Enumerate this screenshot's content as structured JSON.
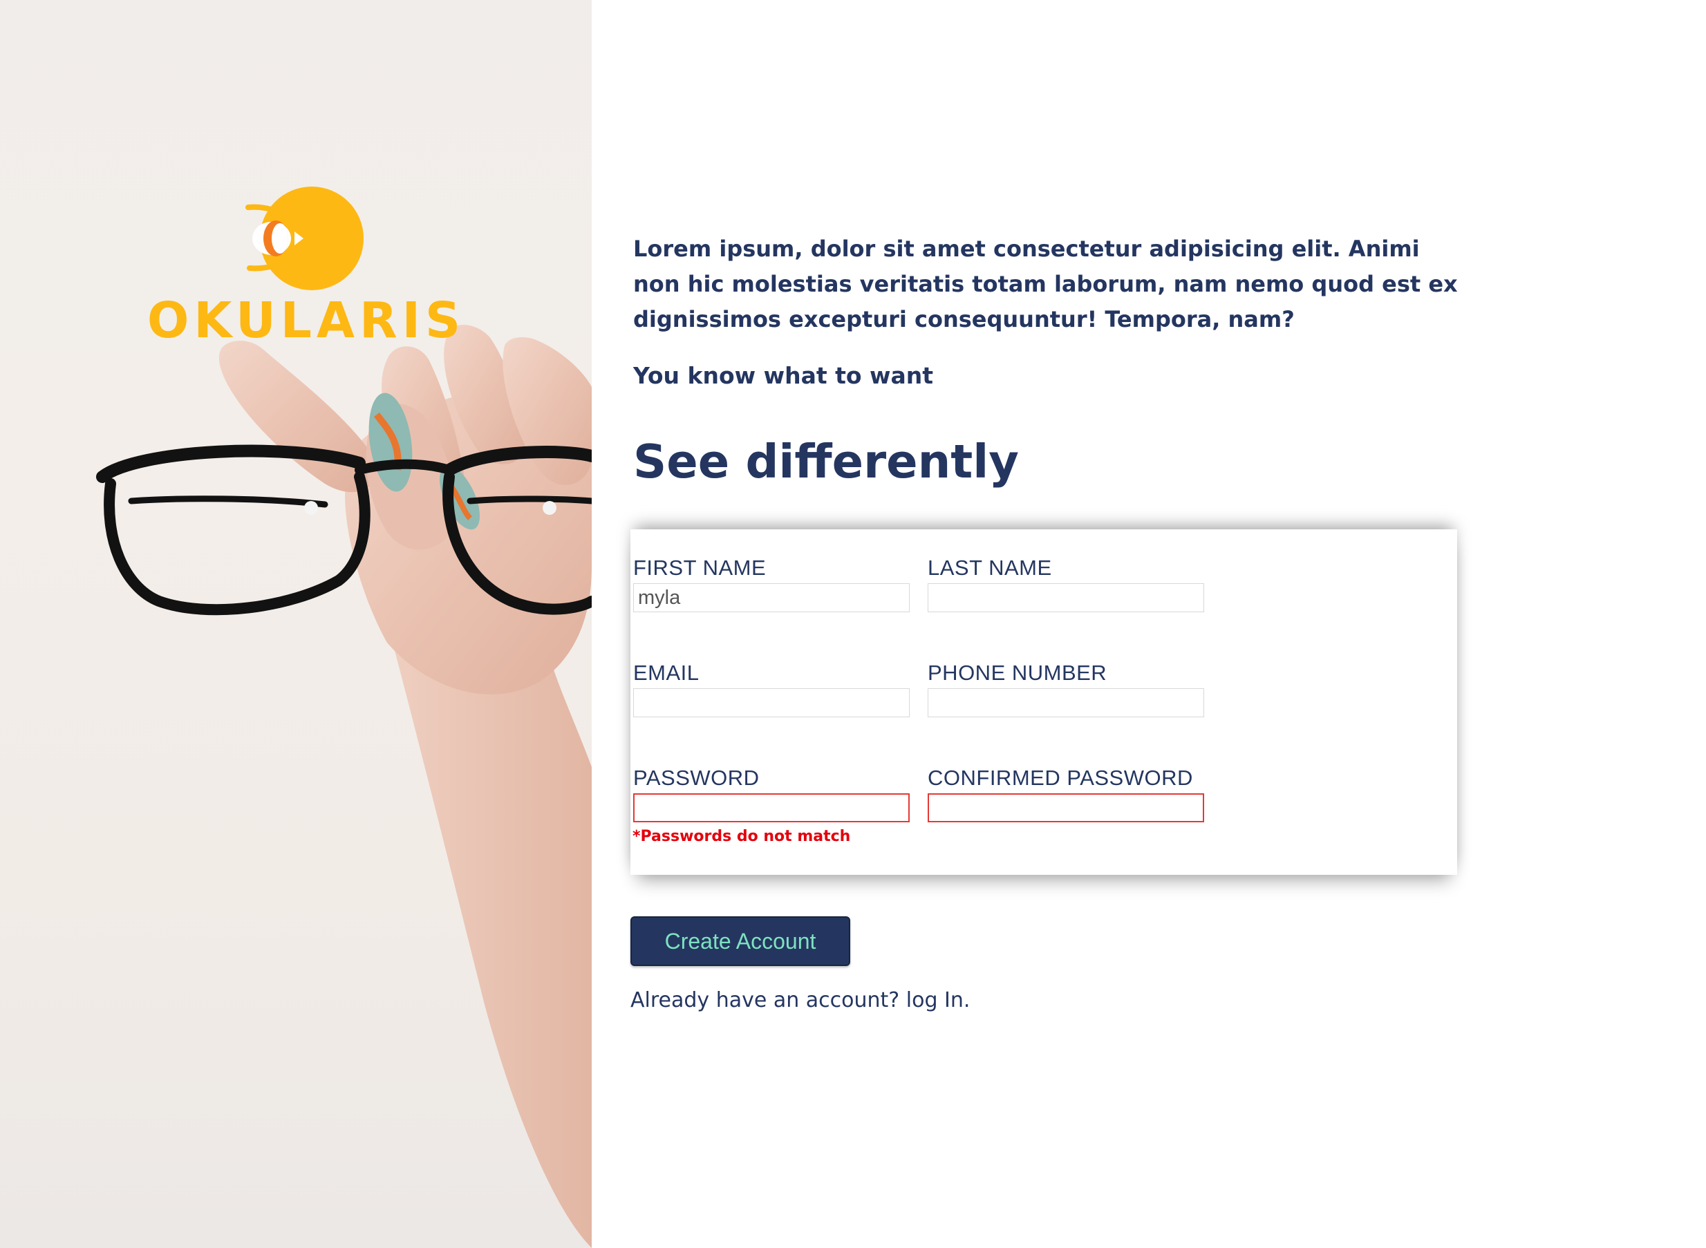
{
  "brand": {
    "name": "OKULARIS",
    "color": "#fdb813"
  },
  "intro": {
    "paragraph": "Lorem ipsum, dolor sit amet consectetur adipisicing elit. Animi non hic molestias veritatis totam laborum, nam nemo quod est ex dignissimos excepturi consequuntur! Tempora, nam?",
    "tagline": "You know what to want",
    "headline": "See differently"
  },
  "form": {
    "first_name": {
      "label": "FIRST NAME",
      "value": "myla"
    },
    "last_name": {
      "label": "LAST NAME",
      "value": ""
    },
    "email": {
      "label": "EMAIL",
      "value": ""
    },
    "phone": {
      "label": "PHONE NUMBER",
      "value": ""
    },
    "password": {
      "label": "PASSWORD",
      "value": ""
    },
    "confirm_password": {
      "label": "CONFIRMED PASSWORD",
      "value": ""
    },
    "error": "*Passwords do not match"
  },
  "actions": {
    "create_label": "Create Account",
    "login_prompt": "Already have an account?",
    "login_link": "log In."
  },
  "colors": {
    "primary": "#243660",
    "button_text": "#7ee2c0",
    "error": "#e3000b"
  },
  "icons": {
    "logo": "eye-orb-logo-icon",
    "hero": "hand-holding-glasses-photo"
  }
}
